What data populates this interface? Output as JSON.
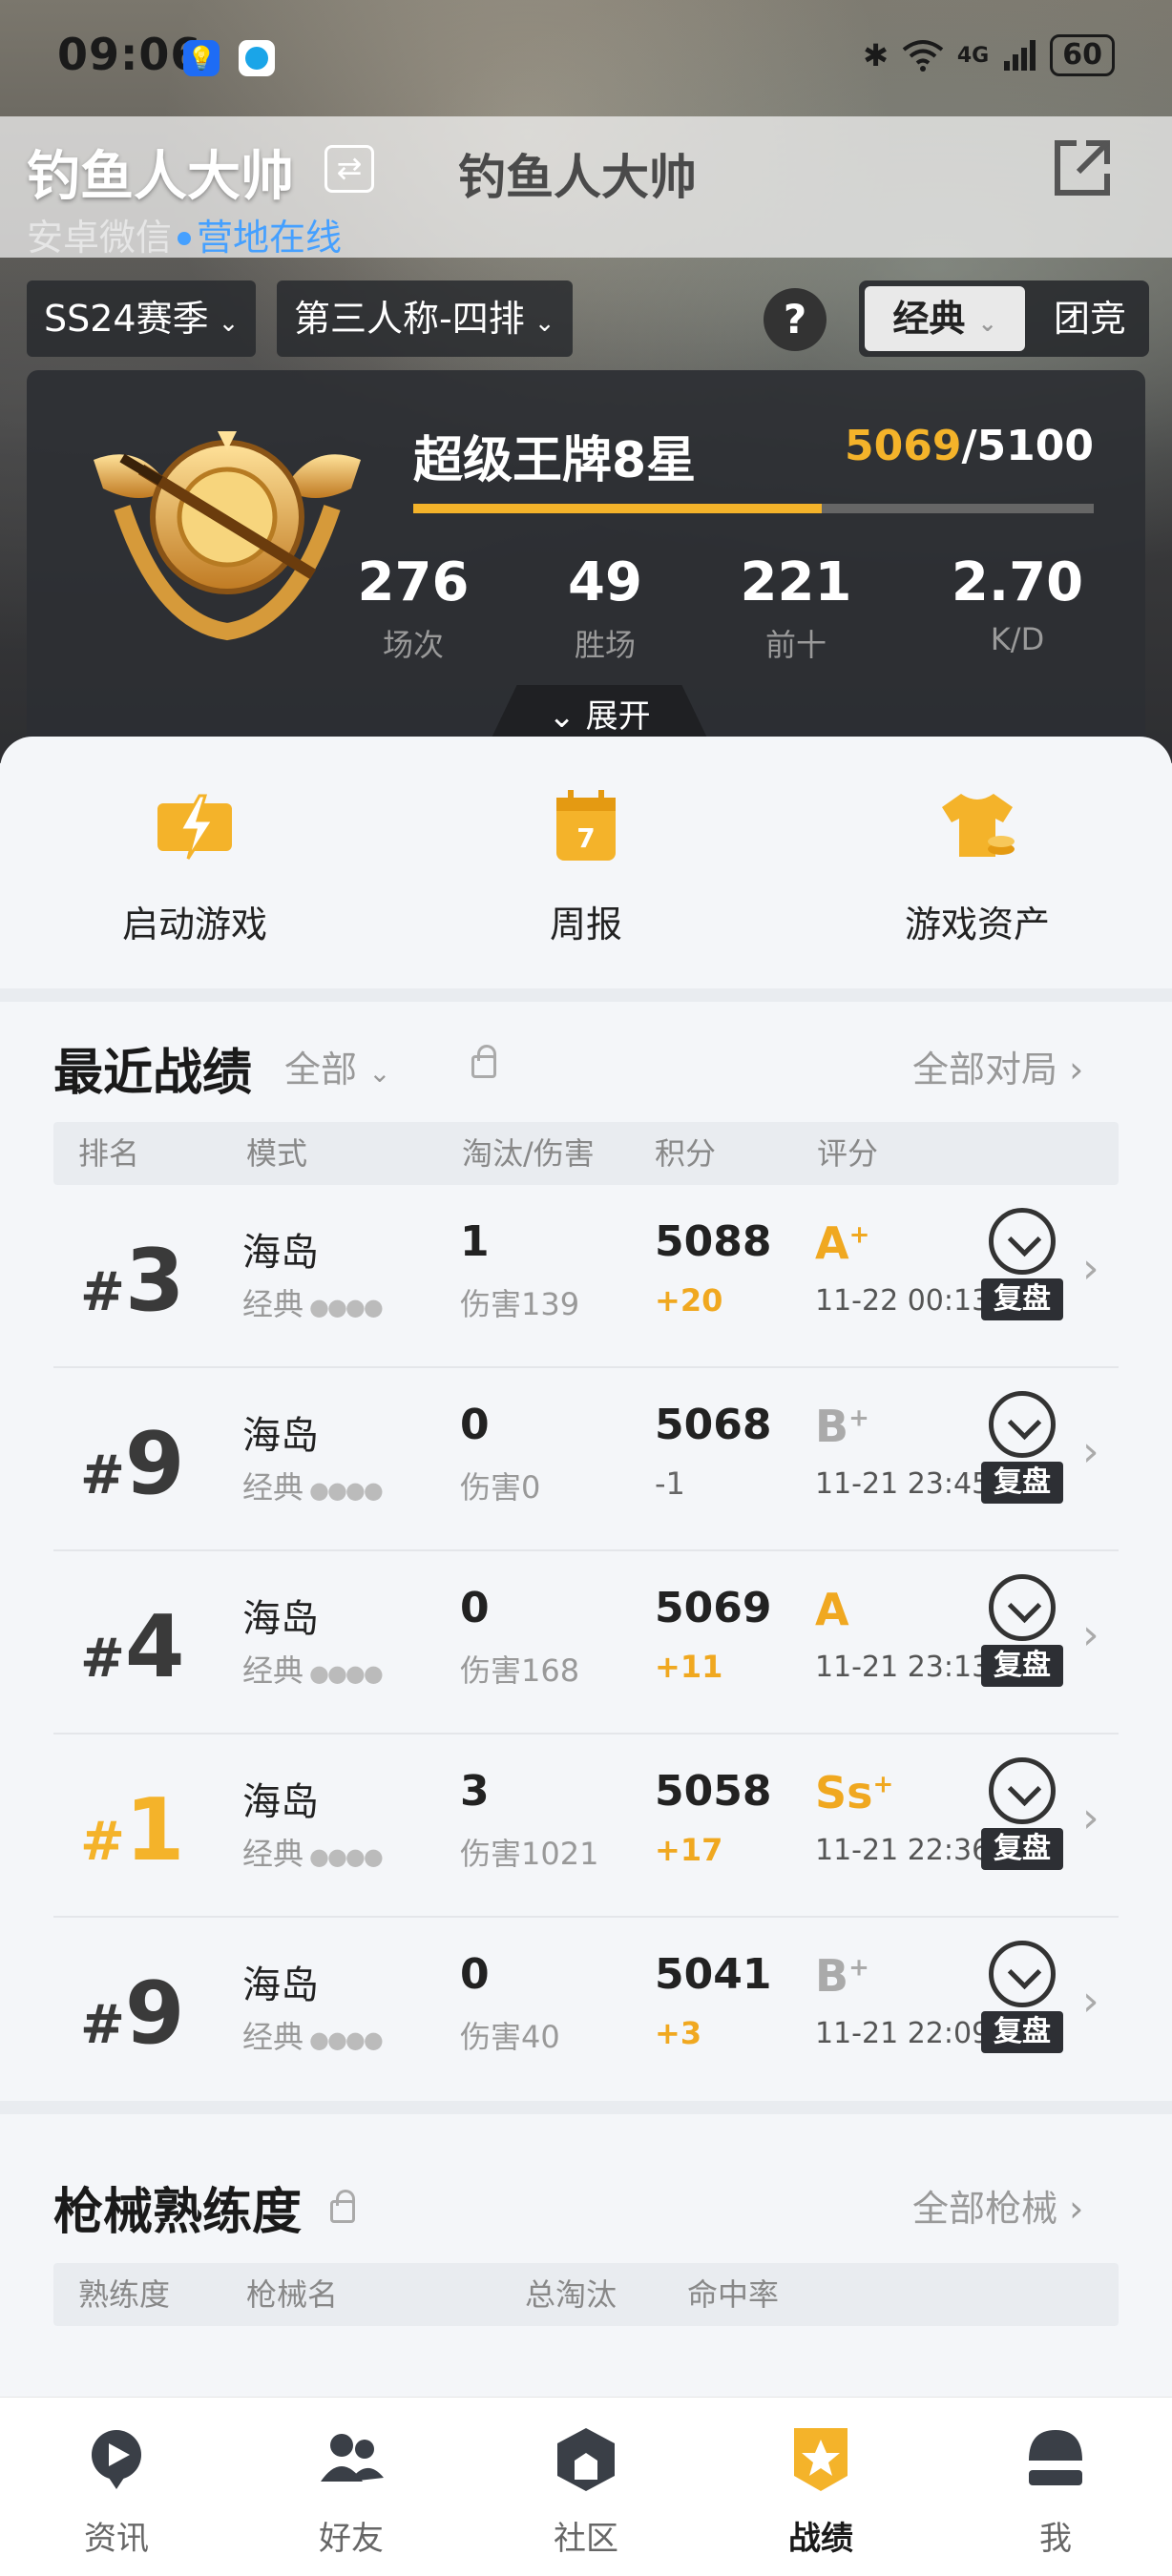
{
  "status_bar": {
    "time": "09:06",
    "network": "4G",
    "battery": "60"
  },
  "header": {
    "nickname": "钓鱼人大帅",
    "nickname_alt": "钓鱼人大帅",
    "platform": "安卓微信",
    "status": "营地在线"
  },
  "filters": {
    "season": "SS24赛季",
    "mode": "第三人称-四排",
    "help": "?",
    "toggle_on": "经典",
    "toggle_off": "团竞"
  },
  "rank_card": {
    "tier": "超级王牌8星",
    "score_current": "5069",
    "score_target": "/5100",
    "progress": 0.6,
    "stats": [
      {
        "value": "276",
        "label": "场次"
      },
      {
        "value": "49",
        "label": "胜场"
      },
      {
        "value": "221",
        "label": "前十"
      },
      {
        "value": "2.70",
        "label": "K/D"
      }
    ],
    "expand_label": "展开"
  },
  "quick_actions": [
    {
      "label": "启动游戏",
      "icon": "lightning-icon"
    },
    {
      "label": "周报",
      "icon": "calendar-icon",
      "badge": "7"
    },
    {
      "label": "游戏资产",
      "icon": "shirt-icon"
    }
  ],
  "recent": {
    "title": "最近战绩",
    "filter": "全部",
    "link": "全部对局",
    "columns": [
      "排名",
      "模式",
      "淘汰/伤害",
      "积分",
      "评分"
    ],
    "rows": [
      {
        "rank": "3",
        "mode": "海岛",
        "sub": "经典",
        "kills": "1",
        "damage": "伤害139",
        "points": "5088",
        "delta": "+20",
        "grade": "A",
        "grade_sup": "+",
        "date": "11-22 00:13",
        "replay": "复盘"
      },
      {
        "rank": "9",
        "mode": "海岛",
        "sub": "经典",
        "kills": "0",
        "damage": "伤害0",
        "points": "5068",
        "delta": "-1",
        "grade": "B",
        "grade_sup": "+",
        "date": "11-21 23:45",
        "replay": "复盘"
      },
      {
        "rank": "4",
        "mode": "海岛",
        "sub": "经典",
        "kills": "0",
        "damage": "伤害168",
        "points": "5069",
        "delta": "+11",
        "grade": "A",
        "grade_sup": "",
        "date": "11-21 23:13",
        "replay": "复盘"
      },
      {
        "rank": "1",
        "mode": "海岛",
        "sub": "经典",
        "kills": "3",
        "damage": "伤害1021",
        "points": "5058",
        "delta": "+17",
        "grade": "Ss",
        "grade_sup": "+",
        "date": "11-21 22:36",
        "replay": "复盘"
      },
      {
        "rank": "9",
        "mode": "海岛",
        "sub": "经典",
        "kills": "0",
        "damage": "伤害40",
        "points": "5041",
        "delta": "+3",
        "grade": "B",
        "grade_sup": "+",
        "date": "11-21 22:09",
        "replay": "复盘"
      }
    ]
  },
  "weapons": {
    "title": "枪械熟练度",
    "link": "全部枪械",
    "columns": [
      "熟练度",
      "枪械名",
      "总淘汰",
      "命中率"
    ]
  },
  "bottom_nav": [
    {
      "label": "资讯",
      "icon": "news-icon"
    },
    {
      "label": "好友",
      "icon": "friends-icon"
    },
    {
      "label": "社区",
      "icon": "community-icon"
    },
    {
      "label": "战绩",
      "icon": "record-icon",
      "active": true
    },
    {
      "label": "我",
      "icon": "profile-icon"
    }
  ],
  "colors": {
    "accent": "#f4b32a",
    "online": "#45a0ff",
    "dark": "#2d2f34"
  }
}
